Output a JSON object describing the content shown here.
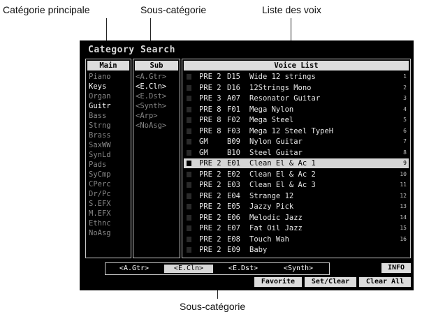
{
  "callouts": {
    "main_category": "Catégorie principale",
    "sub_category_top": "Sous-catégorie",
    "voice_list": "Liste des voix",
    "sub_category_bottom": "Sous-catégorie"
  },
  "screen": {
    "title": "Category Search",
    "main_header": "Main",
    "sub_header": "Sub",
    "voice_header": "Voice List",
    "main_items": [
      {
        "label": "Piano",
        "selected": false
      },
      {
        "label": "Keys",
        "selected": true
      },
      {
        "label": "Organ",
        "selected": false
      },
      {
        "label": "Guitr",
        "selected": true
      },
      {
        "label": "Bass",
        "selected": false
      },
      {
        "label": "Strng",
        "selected": false
      },
      {
        "label": "Brass",
        "selected": false
      },
      {
        "label": "SaxWW",
        "selected": false
      },
      {
        "label": "SynLd",
        "selected": false
      },
      {
        "label": "Pads",
        "selected": false
      },
      {
        "label": "SyCmp",
        "selected": false
      },
      {
        "label": "CPerc",
        "selected": false
      },
      {
        "label": "Dr/Pc",
        "selected": false
      },
      {
        "label": "S.EFX",
        "selected": false
      },
      {
        "label": "M.EFX",
        "selected": false
      },
      {
        "label": "Ethnc",
        "selected": false
      },
      {
        "label": "NoAsg",
        "selected": false
      }
    ],
    "sub_items": [
      {
        "label": "<A.Gtr>",
        "selected": false
      },
      {
        "label": "<E.Cln>",
        "selected": true
      },
      {
        "label": "<E.Dst>",
        "selected": false
      },
      {
        "label": "<Synth>",
        "selected": false
      },
      {
        "label": "<Arp>",
        "selected": false
      },
      {
        "label": "<NoAsg>",
        "selected": false
      }
    ],
    "voices": [
      {
        "bank": "PRE 2",
        "num": "D15",
        "name": "Wide 12 strings",
        "idx": "1"
      },
      {
        "bank": "PRE 2",
        "num": "D16",
        "name": "12Strings Mono",
        "idx": "2"
      },
      {
        "bank": "PRE 3",
        "num": "A07",
        "name": "Resonator Guitar",
        "idx": "3"
      },
      {
        "bank": "PRE 8",
        "num": "F01",
        "name": "Mega Nylon",
        "idx": "4"
      },
      {
        "bank": "PRE 8",
        "num": "F02",
        "name": "Mega Steel",
        "idx": "5"
      },
      {
        "bank": "PRE 8",
        "num": "F03",
        "name": "Mega 12 Steel TypeH",
        "idx": "6"
      },
      {
        "bank": "GM",
        "num": "B09",
        "name": "Nylon Guitar",
        "idx": "7"
      },
      {
        "bank": "GM",
        "num": "B10",
        "name": "Steel Guitar",
        "idx": "8"
      },
      {
        "bank": "PRE 2",
        "num": "E01",
        "name": "Clean El & Ac 1",
        "idx": "9"
      },
      {
        "bank": "PRE 2",
        "num": "E02",
        "name": "Clean El & Ac 2",
        "idx": "10"
      },
      {
        "bank": "PRE 2",
        "num": "E03",
        "name": "Clean El & Ac 3",
        "idx": "11"
      },
      {
        "bank": "PRE 2",
        "num": "E04",
        "name": "Strange 12",
        "idx": "12"
      },
      {
        "bank": "PRE 2",
        "num": "E05",
        "name": "Jazzy Pick",
        "idx": "13"
      },
      {
        "bank": "PRE 2",
        "num": "E06",
        "name": "Melodic Jazz",
        "idx": "14"
      },
      {
        "bank": "PRE 2",
        "num": "E07",
        "name": "Fat Oil Jazz",
        "idx": "15"
      },
      {
        "bank": "PRE 2",
        "num": "E08",
        "name": "Touch Wah",
        "idx": "16"
      },
      {
        "bank": "PRE 2",
        "num": "E09",
        "name": "Baby",
        "idx": ""
      }
    ],
    "highlighted_voice": 8,
    "tabs": [
      {
        "label": "<A.Gtr>",
        "active": false
      },
      {
        "label": "<E.Cln>",
        "active": true
      },
      {
        "label": "<E.Dst>",
        "active": false
      },
      {
        "label": "<Synth>",
        "active": false
      }
    ],
    "buttons": {
      "info": "INFO",
      "favorite": "Favorite",
      "set_clear": "Set/Clear",
      "clear_all": "Clear All"
    }
  }
}
